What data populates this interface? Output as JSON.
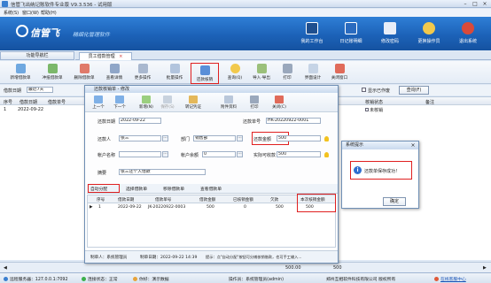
{
  "app": {
    "title": "信管飞出纳记账软件专业版 V9.3.536 - 试用版"
  },
  "menubar": {
    "items": [
      "系统(S)",
      "窗口(W)",
      "帮助(H)"
    ]
  },
  "banner": {
    "logo_text": "信管飞",
    "slogan": "精细化管理软件",
    "buttons": [
      "我的工作台",
      "日记账明细",
      "修改密码",
      "更换操作员",
      "退出系统"
    ],
    "button_colors": [
      "#1f4f8f",
      "#2a6bbf",
      "#3b79c9",
      "#2b6ec5",
      "#d94a3a"
    ]
  },
  "left_panel": {
    "title": "功能导航栏"
  },
  "tabs": [
    {
      "label": "员工借款管理",
      "closable": "×"
    }
  ],
  "toolbar": {
    "items": [
      "新增借款单",
      "冲抵借款单",
      "删除借款单",
      "查看详情",
      "更多操作",
      "批量操作",
      "还款核销",
      "查询(Q)",
      "导入·导出",
      "打印",
      "界面设计",
      "关闭窗口"
    ]
  },
  "filter": {
    "label": "借款日期",
    "value": "最近7天",
    "checkbox": "显示已作废",
    "search": "查询(F)"
  },
  "main_grid": {
    "columns": [
      "序号",
      "借款日期",
      "借款单号",
      "核销状态",
      "备注"
    ],
    "row": {
      "no": "1",
      "date": "2022-09-22",
      "status": "未核销"
    }
  },
  "bottom_bar": {
    "left": "◀",
    "right": "▶",
    "totals": [
      "500.00",
      "500"
    ]
  },
  "dialog": {
    "title": "还款核销单 - 修改",
    "toolbar": [
      "上一个",
      "下一个",
      "新增(N)",
      "保存(S)",
      "转记凭证",
      "附件资料",
      "打印",
      "关闭(C)"
    ],
    "fields": {
      "repay_date_label": "还款日期",
      "repay_date": "2022-09-22",
      "doc_no_label": "还款单号",
      "doc_no": "HK-20220922-0001",
      "repayer_label": "还款人",
      "repayer": "张三",
      "dept_label": "部门",
      "dept": "销售部",
      "amount_label": "还款金额",
      "amount": "500",
      "account_label": "帐户名称",
      "account": "",
      "acct_balance_label": "帐户余额",
      "acct_balance": "0",
      "actual_label": "实际可收款",
      "actual": "500",
      "summary_label": "摘要",
      "summary": "张三还个人借款"
    },
    "sub_toolbar": [
      "自动分配",
      "选择借款单",
      "移除借款单",
      "查看借款单"
    ],
    "sub_grid": {
      "columns": [
        "序号",
        "借款日期",
        "借款单号",
        "借款金额",
        "已核销金额",
        "欠款",
        "本次核销金额"
      ],
      "row": {
        "no": "1",
        "date": "2022-09-22",
        "doc": "JK-20220922-0003",
        "amount": "500",
        "written": "0",
        "owed": "500",
        "this": "500"
      }
    },
    "footer": {
      "maker": "制单人：系统管理员",
      "made_date": "制单日期：2022-09-22 14:39",
      "tip": "提示：点\"自动分配\"按钮可分摊核销借款，也可手工输入..."
    }
  },
  "message": {
    "title": "系统提示",
    "text": "还款单保存成功！",
    "ok": "确定",
    "icon": "i"
  },
  "status": {
    "server": "远程服务器：127.0.0.1:7092",
    "connect": "连接状态：正常",
    "user": "你好：演示数据",
    "operator": "操作员：系统管理员(admin)",
    "company": "郑州互相软件科技有限公司 版权所有",
    "online": "在线客服中心"
  }
}
